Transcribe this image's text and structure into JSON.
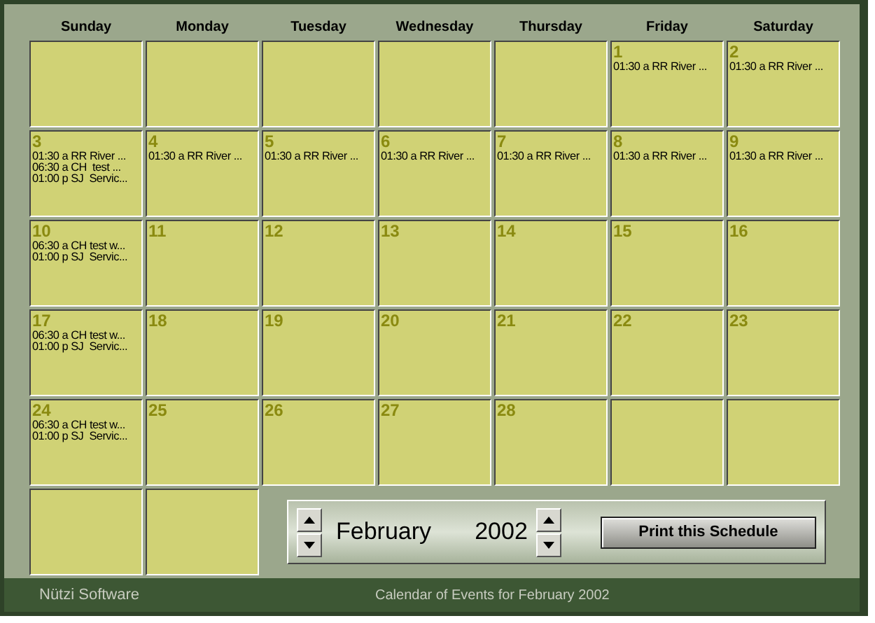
{
  "day_headers": [
    "Sunday",
    "Monday",
    "Tuesday",
    "Wednesday",
    "Thursday",
    "Friday",
    "Saturday"
  ],
  "weeks": [
    [
      {
        "kind": "empty"
      },
      {
        "kind": "empty"
      },
      {
        "kind": "empty"
      },
      {
        "kind": "empty"
      },
      {
        "kind": "empty"
      },
      {
        "kind": "day",
        "day": "1",
        "events": [
          "01:30 a RR River ..."
        ]
      },
      {
        "kind": "day",
        "day": "2",
        "events": [
          "01:30 a RR River ..."
        ]
      }
    ],
    [
      {
        "kind": "day",
        "day": "3",
        "events": [
          "01:30 a RR River ...",
          "06:30 a CH  test ...",
          "01:00 p SJ  Servic..."
        ]
      },
      {
        "kind": "day",
        "day": "4",
        "events": [
          "01:30 a RR River ..."
        ]
      },
      {
        "kind": "day",
        "day": "5",
        "events": [
          "01:30 a RR River ..."
        ]
      },
      {
        "kind": "day",
        "day": "6",
        "events": [
          "01:30 a RR River ..."
        ]
      },
      {
        "kind": "day",
        "day": "7",
        "events": [
          "01:30 a RR River ..."
        ]
      },
      {
        "kind": "day",
        "day": "8",
        "events": [
          "01:30 a RR River ..."
        ]
      },
      {
        "kind": "day",
        "day": "9",
        "events": [
          "01:30 a RR River ..."
        ]
      }
    ],
    [
      {
        "kind": "day",
        "day": "10",
        "events": [
          "06:30 a CH test w...",
          "01:00 p SJ  Servic..."
        ]
      },
      {
        "kind": "day",
        "day": "11"
      },
      {
        "kind": "day",
        "day": "12"
      },
      {
        "kind": "day",
        "day": "13"
      },
      {
        "kind": "day",
        "day": "14"
      },
      {
        "kind": "day",
        "day": "15"
      },
      {
        "kind": "day",
        "day": "16"
      }
    ],
    [
      {
        "kind": "day",
        "day": "17",
        "events": [
          "06:30 a CH test w...",
          "01:00 p SJ  Servic..."
        ]
      },
      {
        "kind": "day",
        "day": "18"
      },
      {
        "kind": "day",
        "day": "19"
      },
      {
        "kind": "day",
        "day": "20"
      },
      {
        "kind": "day",
        "day": "21"
      },
      {
        "kind": "day",
        "day": "22"
      },
      {
        "kind": "day",
        "day": "23"
      }
    ],
    [
      {
        "kind": "day",
        "day": "24",
        "events": [
          "06:30 a CH test w...",
          "01:00 p SJ  Servic..."
        ]
      },
      {
        "kind": "day",
        "day": "25"
      },
      {
        "kind": "day",
        "day": "26"
      },
      {
        "kind": "day",
        "day": "27"
      },
      {
        "kind": "day",
        "day": "28"
      },
      {
        "kind": "empty"
      },
      {
        "kind": "empty"
      }
    ],
    [
      {
        "kind": "empty"
      },
      {
        "kind": "empty"
      }
    ]
  ],
  "controls": {
    "month": "February",
    "year": "2002",
    "print_button": "Print this Schedule"
  },
  "footer": {
    "company": "Nützi Software",
    "caption": "Calendar of Events for February 2002"
  }
}
